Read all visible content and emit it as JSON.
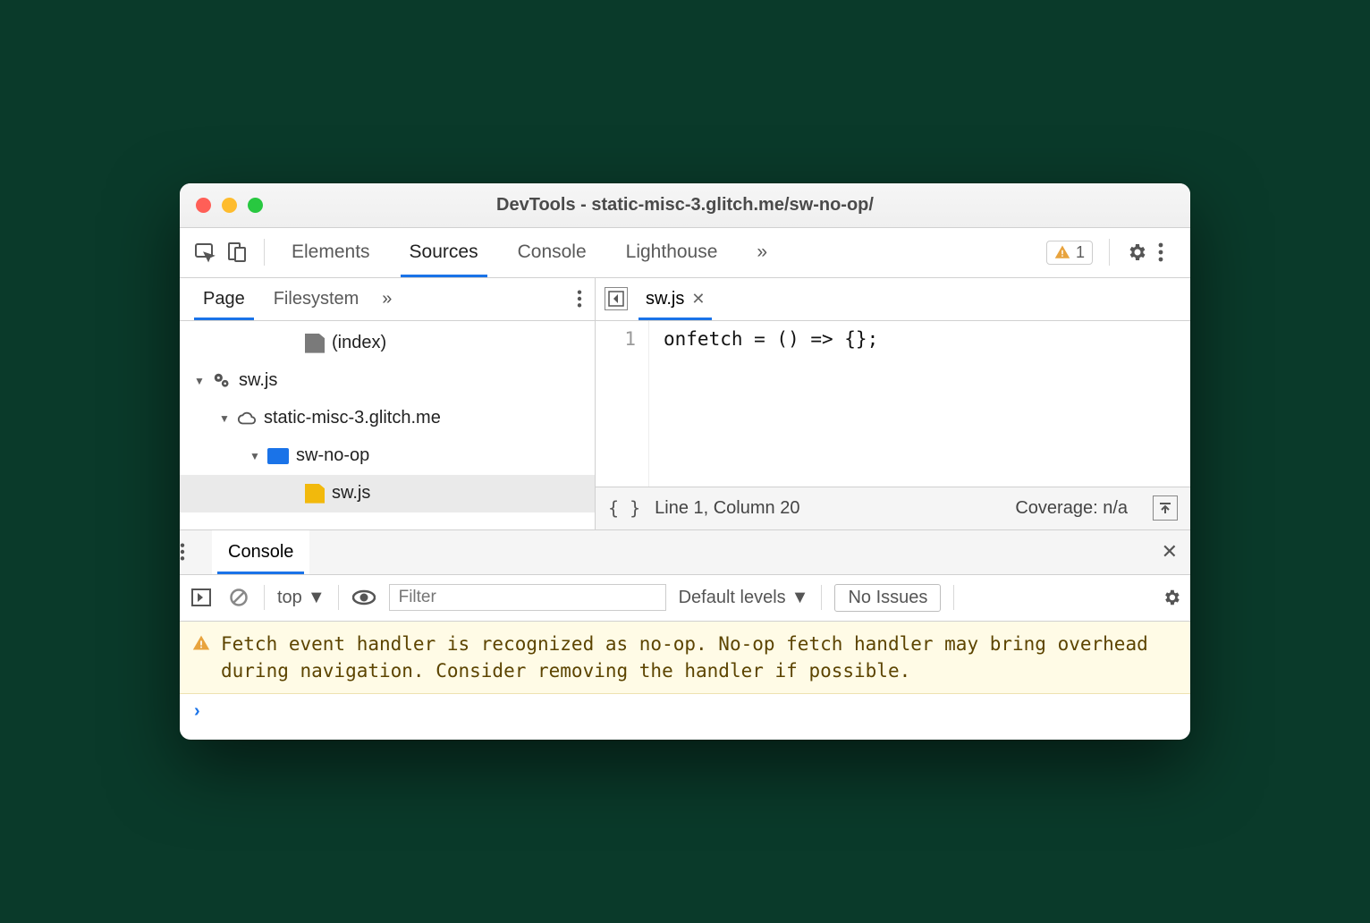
{
  "window_title": "DevTools - static-misc-3.glitch.me/sw-no-op/",
  "toolbar": {
    "tabs": [
      "Elements",
      "Sources",
      "Console",
      "Lighthouse"
    ],
    "active_tab": "Sources",
    "warning_count": "1"
  },
  "left_panel": {
    "tabs": [
      "Page",
      "Filesystem"
    ],
    "active_tab": "Page",
    "tree": {
      "index_label": "(index)",
      "sw_root": "sw.js",
      "domain": "static-misc-3.glitch.me",
      "folder": "sw-no-op",
      "file": "sw.js"
    }
  },
  "editor": {
    "open_file": "sw.js",
    "line_number": "1",
    "code_line": "onfetch = () => {};"
  },
  "status": {
    "pretty_symbol": "{ }",
    "cursor": "Line 1, Column 20",
    "coverage": "Coverage: n/a"
  },
  "drawer": {
    "tab": "Console"
  },
  "console_toolbar": {
    "context": "top",
    "filter_placeholder": "Filter",
    "levels": "Default levels",
    "issues": "No Issues"
  },
  "console_log": {
    "warning": "Fetch event handler is recognized as no-op. No-op fetch handler may bring overhead during navigation. Consider removing the handler if possible."
  }
}
